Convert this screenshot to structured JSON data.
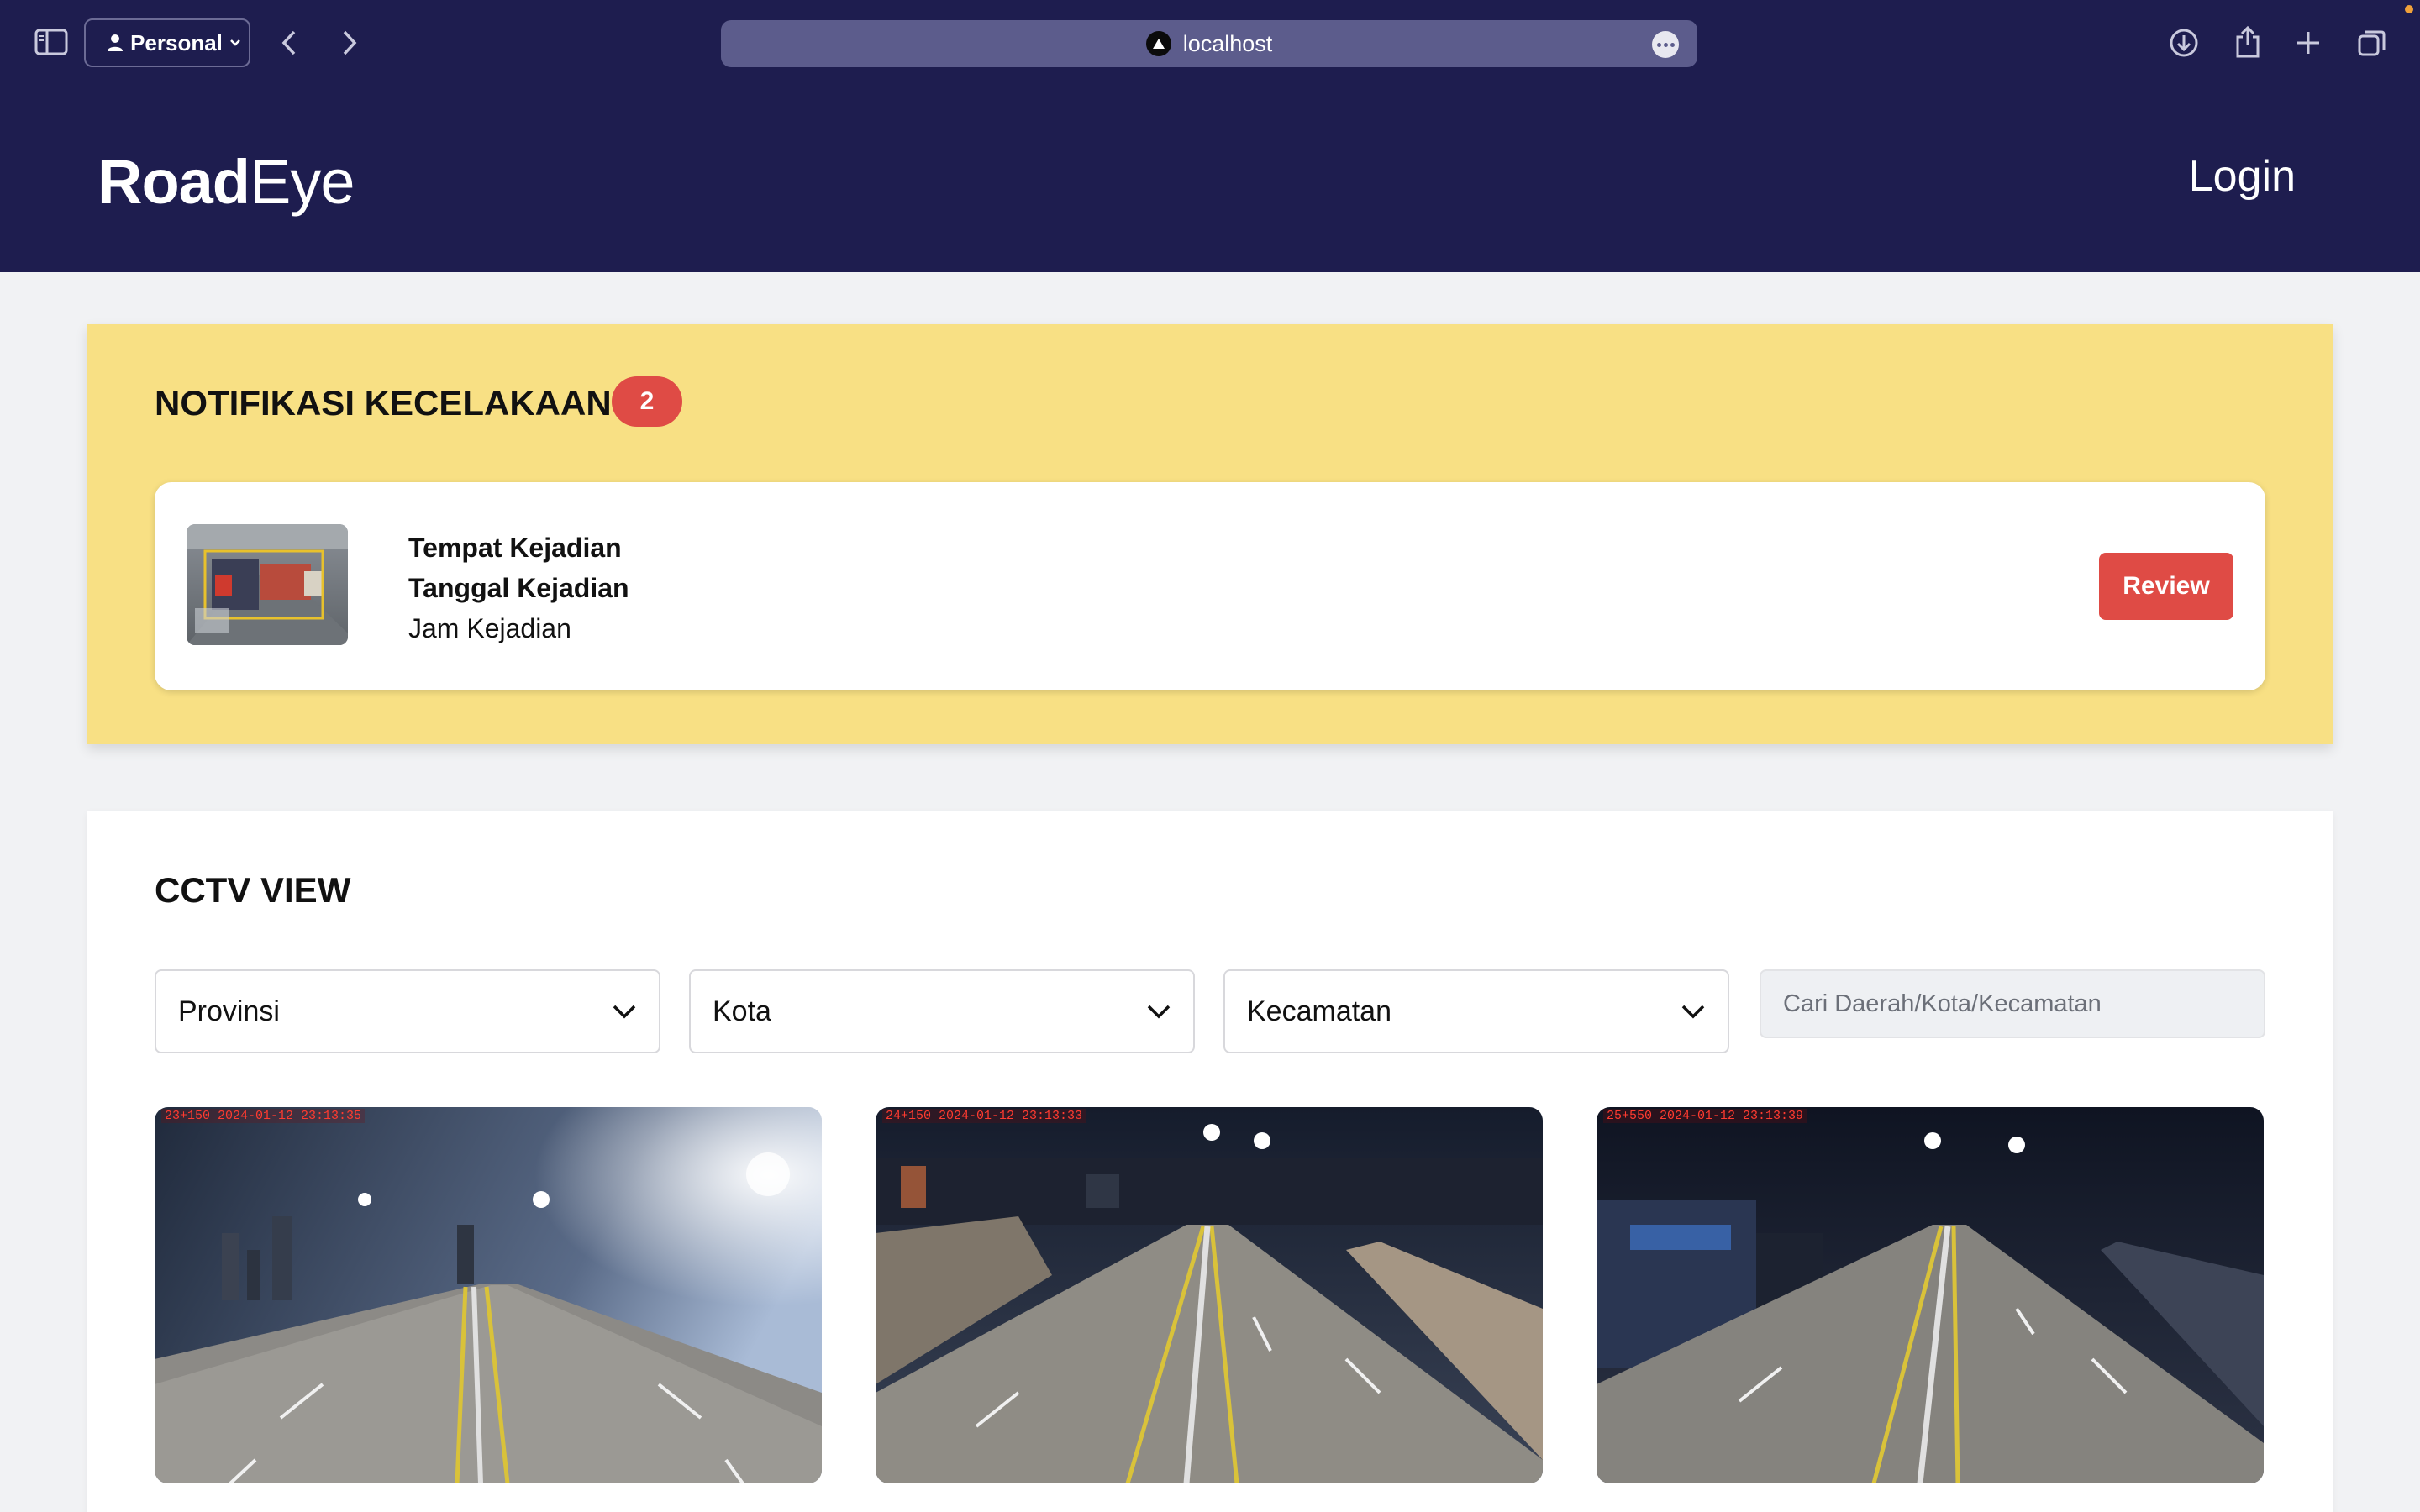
{
  "browser": {
    "profile_label": "Personal",
    "url": "localhost"
  },
  "header": {
    "brand_bold": "Road",
    "brand_light": "Eye",
    "login_label": "Login"
  },
  "notifications": {
    "title": "NOTIFIKASI KECELAKAAN",
    "count": "2",
    "items": [
      {
        "place_label": "Tempat Kejadian",
        "date_label": "Tanggal Kejadian",
        "time_label": "Jam Kejadian",
        "review_label": "Review"
      }
    ]
  },
  "cctv": {
    "title": "CCTV VIEW",
    "filters": {
      "province": "Provinsi",
      "city": "Kota",
      "district": "Kecamatan",
      "search_placeholder": "Cari Daerah/Kota/Kecamatan"
    },
    "cameras": [
      {
        "overlay": "23+150  2024-01-12  23:13:35"
      },
      {
        "overlay": "24+150  2024-01-12  23:13:33"
      },
      {
        "overlay": "25+550  2024-01-12  23:13:39"
      }
    ]
  },
  "colors": {
    "nav_bg": "#1e1d4f",
    "notif_bg": "#f8e084",
    "accent_red": "#df4b45",
    "page_bg": "#f1f2f4"
  }
}
